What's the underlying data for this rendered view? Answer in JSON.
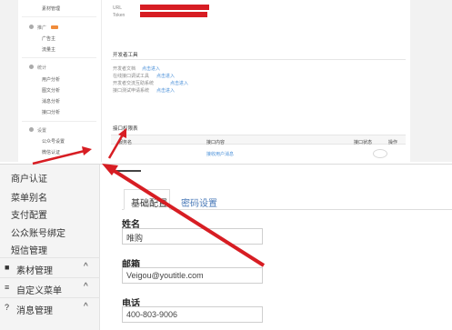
{
  "top_sidebar": {
    "items": [
      {
        "label": "素材管理"
      },
      {
        "label": "推广"
      },
      {
        "label": "广告主"
      },
      {
        "label": "流量主"
      },
      {
        "label": "统计"
      },
      {
        "label": "用户分析"
      },
      {
        "label": "图文分析"
      },
      {
        "label": "消息分析"
      },
      {
        "label": "接口分析"
      },
      {
        "label": "设置"
      },
      {
        "label": "公众号设置"
      },
      {
        "label": "微信认证"
      }
    ]
  },
  "top_main": {
    "url_label": "URL",
    "token_label": "Token",
    "dev_tools_title": "开发者工具",
    "tools": [
      {
        "label": "开发者文档",
        "link": "点击进入"
      },
      {
        "label": "在线接口调试工具",
        "link": "点击进入"
      },
      {
        "label": "开发者交流互助系统",
        "link": "点击进入"
      },
      {
        "label": "接口测试申请系统",
        "link": "点击进入"
      }
    ],
    "permission_title": "接口权限表",
    "table_headers": [
      "服务名",
      "接口内容",
      "接口状态",
      "操作"
    ],
    "table_row_link": "接收用户消息"
  },
  "left_menu": {
    "items": [
      {
        "label": "商户认证"
      },
      {
        "label": "菜单别名"
      },
      {
        "label": "支付配置"
      },
      {
        "label": "公众账号绑定"
      },
      {
        "label": "短信管理"
      }
    ],
    "groups": [
      {
        "icon": "folder-icon",
        "glyph": "■",
        "label": "素材管理",
        "chevron": "^"
      },
      {
        "icon": "menu-icon",
        "glyph": "≡",
        "label": "自定义菜单",
        "chevron": "^"
      },
      {
        "icon": "chat-icon",
        "glyph": "?",
        "label": "消息管理",
        "chevron": "^"
      }
    ]
  },
  "content": {
    "tabs": [
      {
        "label": "基础配置",
        "active": true
      },
      {
        "label": "密码设置",
        "active": false
      }
    ],
    "fields": [
      {
        "label": "姓名",
        "value": "唯购"
      },
      {
        "label": "邮箱",
        "value": "Veigou@youtitle.com"
      },
      {
        "label": "电话",
        "value": "400-803-9006"
      }
    ]
  },
  "colors": {
    "accent": "#d71d23",
    "link": "#4a90d9",
    "new_badge": "#f08c3b"
  }
}
